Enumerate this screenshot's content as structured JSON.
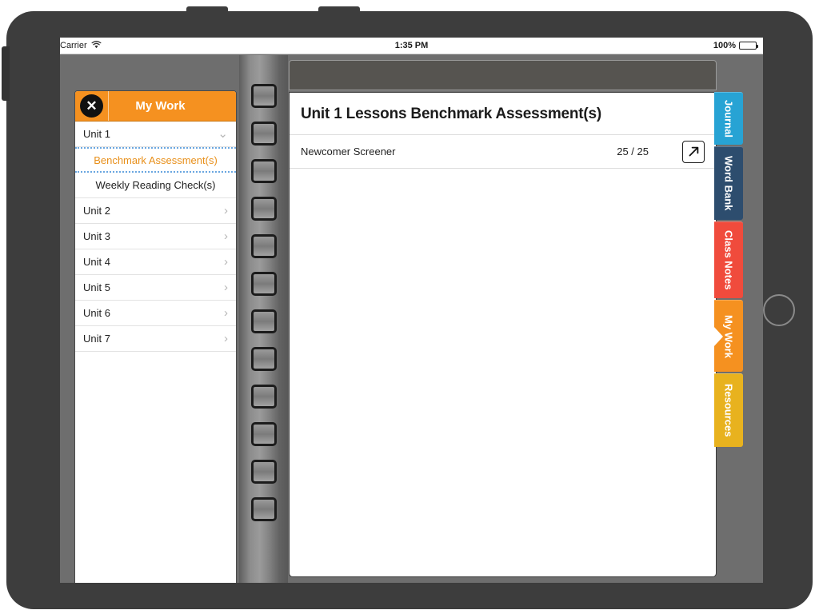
{
  "status_bar": {
    "carrier": "Carrier",
    "wifi_icon": "wifi-icon",
    "time": "1:35 PM",
    "battery_percent": "100%",
    "battery_icon": "battery-full-icon"
  },
  "sidebar": {
    "title": "My Work",
    "close_icon": "✕",
    "items": [
      {
        "label": "Unit 1",
        "type": "unit",
        "chevron": "⌄",
        "expanded": true
      },
      {
        "label": "Benchmark Assessment(s)",
        "type": "sub",
        "selected": true
      },
      {
        "label": "Weekly Reading Check(s)",
        "type": "sub",
        "selected": false
      },
      {
        "label": "Unit 2",
        "type": "unit",
        "chevron": "›",
        "expanded": false
      },
      {
        "label": "Unit 3",
        "type": "unit",
        "chevron": "›",
        "expanded": false
      },
      {
        "label": "Unit 4",
        "type": "unit",
        "chevron": "›",
        "expanded": false
      },
      {
        "label": "Unit 5",
        "type": "unit",
        "chevron": "›",
        "expanded": false
      },
      {
        "label": "Unit 6",
        "type": "unit",
        "chevron": "›",
        "expanded": false
      },
      {
        "label": "Unit 7",
        "type": "unit",
        "chevron": "›",
        "expanded": false
      }
    ]
  },
  "content": {
    "title": "Unit 1 Lessons Benchmark Assessment(s)",
    "rows": [
      {
        "name": "Newcomer Screener",
        "score": "25 / 25",
        "launch_icon": "arrow-up-right-icon"
      }
    ]
  },
  "side_tabs": [
    {
      "label": "Journal",
      "color": "#27a3d4",
      "active": false
    },
    {
      "label": "Word Bank",
      "color": "#2d4d6e",
      "active": false
    },
    {
      "label": "Class Notes",
      "color": "#f04b3c",
      "active": false
    },
    {
      "label": "My Work",
      "color": "#f59120",
      "active": true
    },
    {
      "label": "Resources",
      "color": "#e8b21e",
      "active": false
    }
  ],
  "spiral": {
    "ring_count": 12
  },
  "colors": {
    "accent_orange": "#f59120",
    "selected_text": "#e8901b",
    "focus_outline": "#6aa7e0",
    "device_body": "#3d3d3d",
    "workspace_bg": "#6e6e6e",
    "toolbar_bg": "#565450"
  }
}
